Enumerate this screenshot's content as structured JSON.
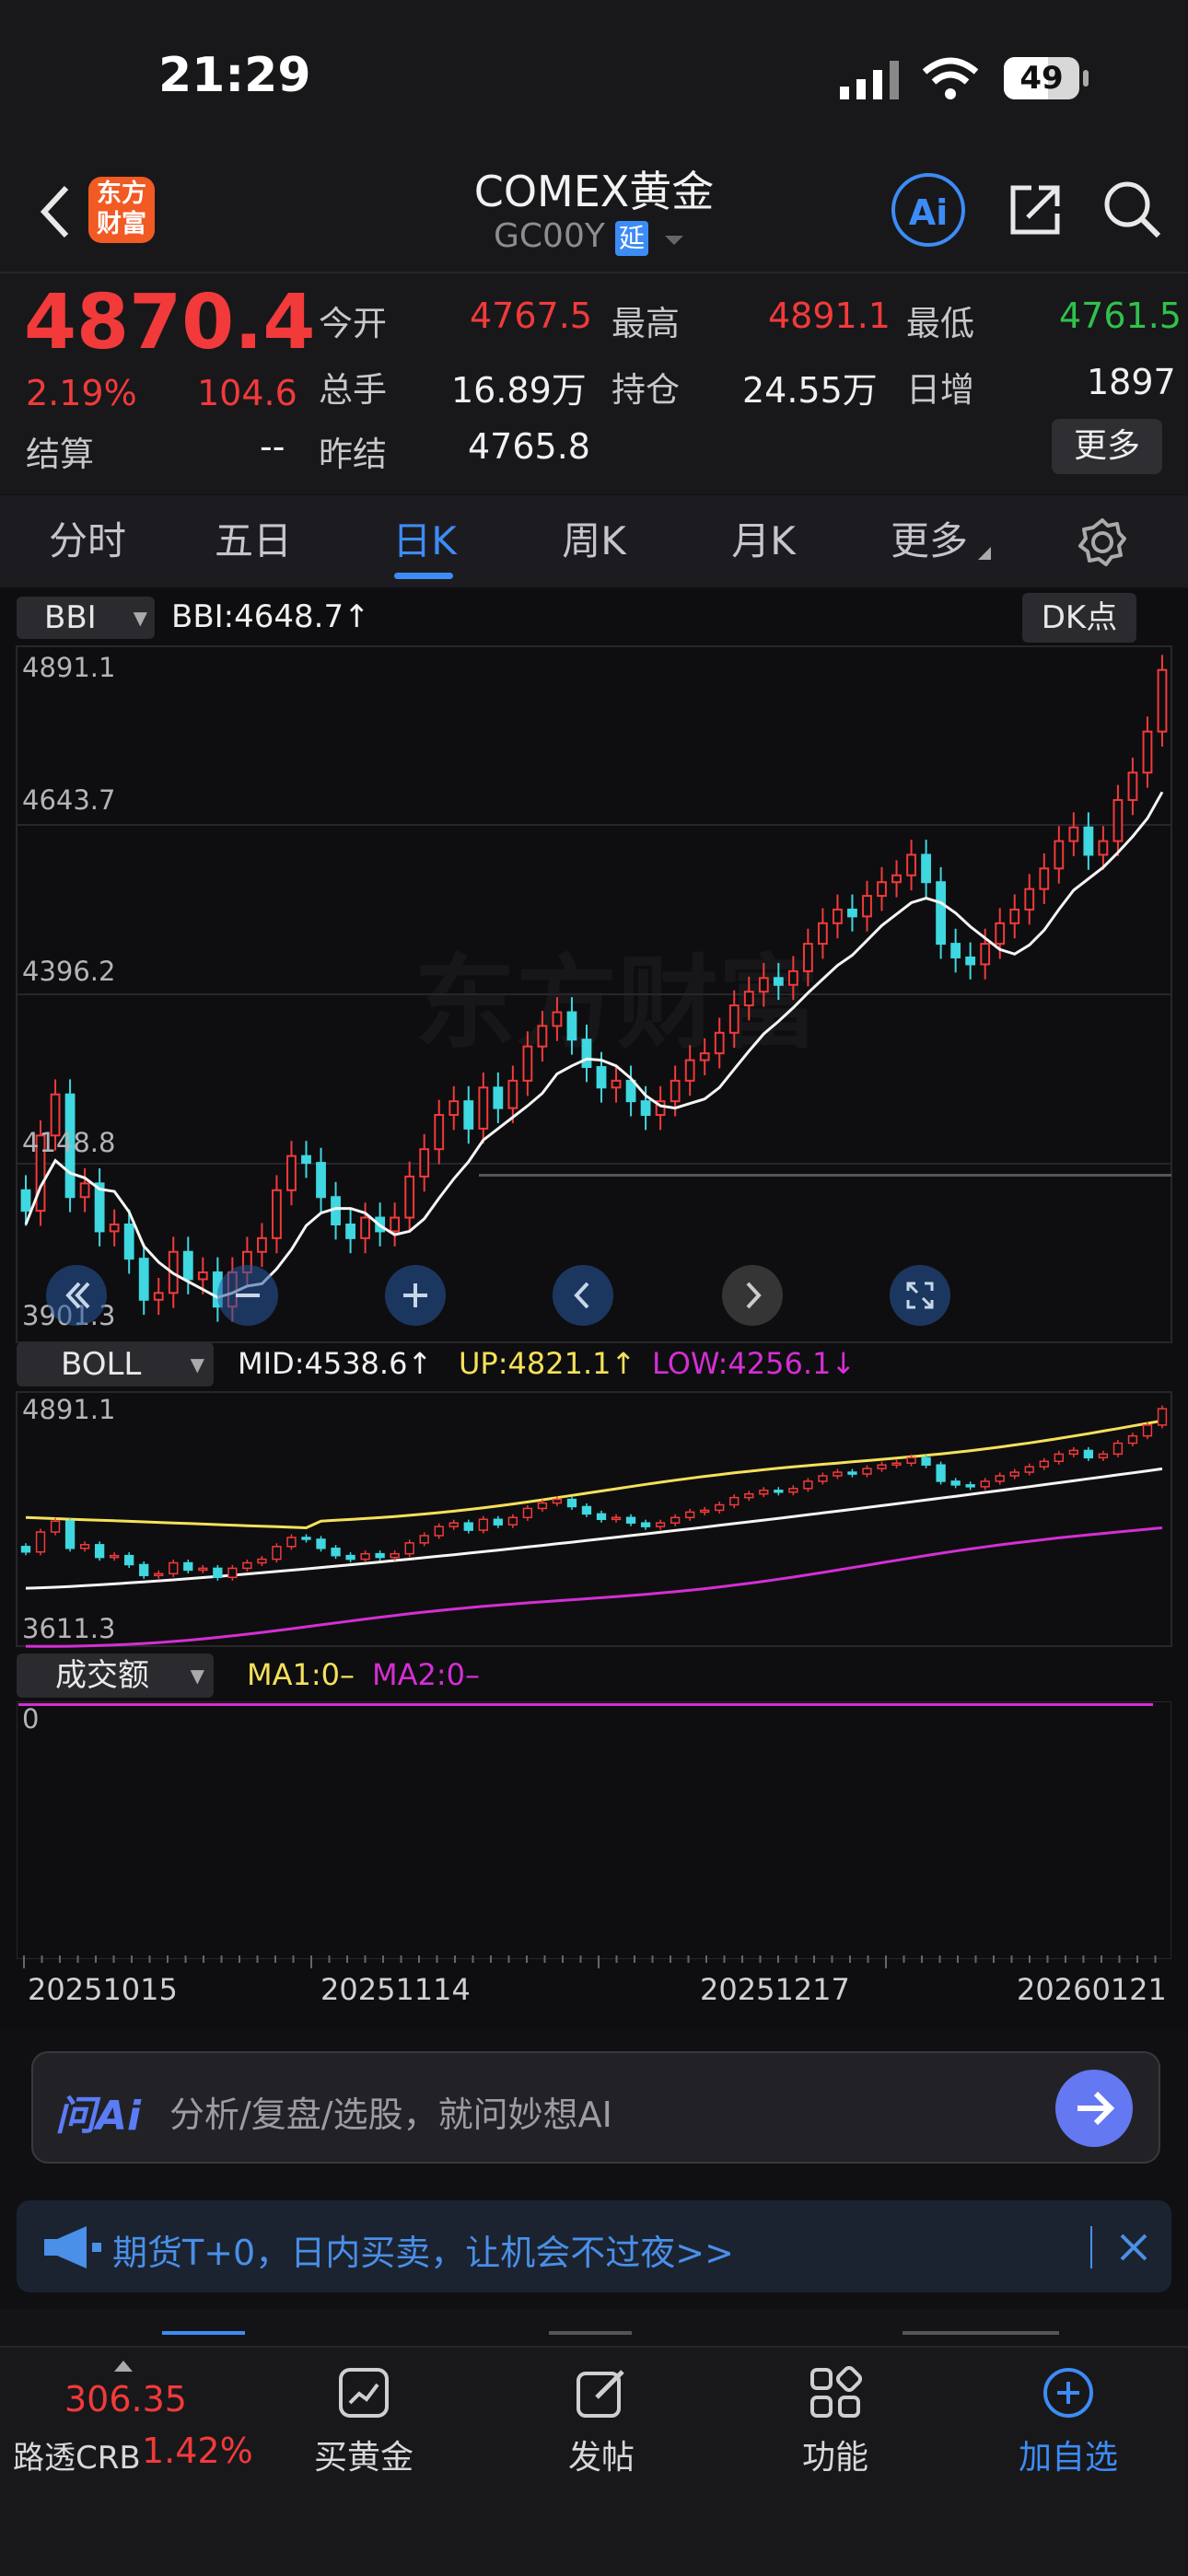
{
  "status": {
    "time": "21:29",
    "battery": "49"
  },
  "header": {
    "logo_text_1": "东方",
    "logo_text_2": "财富",
    "title": "COMEX黄金",
    "code": "GC00Y",
    "delay_badge": "延",
    "ai_label": "Ai"
  },
  "quote": {
    "price": "4870.4",
    "change_pct": "2.19%",
    "change": "104.6",
    "open_label": "今开",
    "open": "4767.5",
    "high_label": "最高",
    "high": "4891.1",
    "low_label": "最低",
    "low": "4761.5",
    "volume_label": "总手",
    "volume": "16.89万",
    "oi_label": "持仓",
    "oi": "24.55万",
    "daily_inc_label": "日增",
    "daily_inc": "1897",
    "settle_label": "结算",
    "settle": "--",
    "prev_settle_label": "昨结",
    "prev_settle": "4765.8",
    "more_button": "更多"
  },
  "tabs": [
    "分时",
    "五日",
    "日K",
    "周K",
    "月K",
    "更多"
  ],
  "main_chart": {
    "indicator": "BBI",
    "indicator_value": "BBI:4648.7↑",
    "dk_button": "DK点",
    "y_labels": [
      "4891.1",
      "4643.7",
      "4396.2",
      "4148.8",
      "3901.3"
    ],
    "watermark": "东方财富"
  },
  "boll_chart": {
    "indicator": "BOLL",
    "mid": "MID:4538.6↑",
    "up": "UP:4821.1↑",
    "low": "LOW:4256.1↓",
    "y_top": "4891.1",
    "y_bottom": "3611.3"
  },
  "volume_chart": {
    "indicator": "成交额",
    "ma1": "MA1:0–",
    "ma2": "MA2:0–",
    "zero_label": "0"
  },
  "x_dates": [
    "20251015",
    "20251114",
    "20251217",
    "20260121"
  ],
  "ask": {
    "brand": "问Ai",
    "placeholder": "分析/复盘/选股，就问妙想AI"
  },
  "banner": {
    "text": "期货T+0，日内买卖，让机会不过夜>>"
  },
  "bottom": {
    "index_value": "306.35",
    "index_name": "路透CRB",
    "index_pct": "1.42%",
    "items": [
      "买黄金",
      "发帖",
      "功能",
      "加自选"
    ]
  },
  "colors": {
    "up": "#f23a3a",
    "down": "#3fd7e0",
    "accent": "#3d8cf5",
    "ma_yellow": "#f5e15a",
    "ma_magenta": "#d42fd4"
  },
  "chart_data": {
    "type": "candlestick",
    "indicator_lines": [
      "BBI",
      "BOLL MID",
      "BOLL UP",
      "BOLL LOW"
    ],
    "ylim": [
      3901.3,
      4891.1
    ],
    "dates": [
      "20251015",
      "20251114",
      "20251217",
      "20260121"
    ],
    "last_close": 4870.4
  }
}
